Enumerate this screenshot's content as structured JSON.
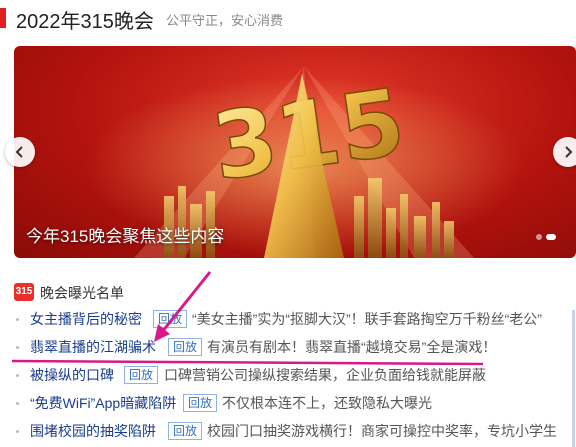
{
  "header": {
    "title": "2022年315晚会",
    "subtitle": "公平守正，安心消费"
  },
  "carousel": {
    "caption": "今年315晚会聚焦这些内容",
    "artwork_text": "315",
    "slide_count": 2,
    "active_slide": 1
  },
  "section": {
    "badge": "315",
    "label": "晚会曝光名单"
  },
  "news": [
    {
      "title": "女主播背后的秘密",
      "tag": "回放",
      "desc": "“美女主播”实为“抠脚大汉”！联手套路掏空万千粉丝“老公”"
    },
    {
      "title": "翡翠直播的江湖骗术",
      "tag": "回放",
      "desc": "有演员有剧本！翡翠直播“越境交易”全是演戏！"
    },
    {
      "title": "被操纵的口碑",
      "tag": "回放",
      "desc": "口碑营销公司操纵搜索结果，企业负面给钱就能屏蔽"
    },
    {
      "title": "“免费WiFi”App暗藏陷阱",
      "tag": "回放",
      "desc": "不仅根本连不上，还致隐私大曝光"
    },
    {
      "title": "围堵校园的抽奖陷阱",
      "tag": "回放",
      "desc": "校园门口抽奖游戏横行！商家可操控中奖率，专坑小学生"
    }
  ],
  "colors": {
    "accent": "#e02020",
    "link": "#1a3d8f",
    "tag_border": "#8fb3e0",
    "annotation": "#d61a8c"
  },
  "icons": {
    "prev": "chevron-left-icon",
    "next": "chevron-right-icon"
  }
}
